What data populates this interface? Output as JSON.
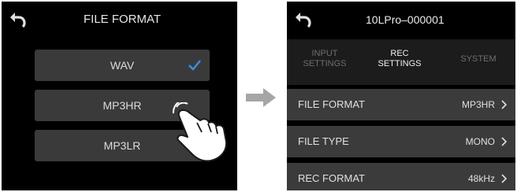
{
  "left_screen": {
    "header": {
      "back_icon": "back-arrow-icon",
      "title": "FILE FORMAT"
    },
    "options": [
      {
        "label": "WAV",
        "selected": true
      },
      {
        "label": "MP3HR",
        "selected": false
      },
      {
        "label": "MP3LR",
        "selected": false
      }
    ],
    "check_icon": "checkmark-icon",
    "pointer_icon": "tap-hand-icon"
  },
  "transition_icon": "right-arrow-icon",
  "right_screen": {
    "header": {
      "back_icon": "back-arrow-icon",
      "title": "10LPro–000001"
    },
    "tabs": [
      {
        "line1": "INPUT",
        "line2": "SETTINGS",
        "active": false
      },
      {
        "line1": "REC",
        "line2": "SETTINGS",
        "active": true
      },
      {
        "line1": "SYSTEM",
        "line2": "",
        "active": false
      }
    ],
    "rows": [
      {
        "label": "FILE FORMAT",
        "value": "MP3HR"
      },
      {
        "label": "FILE TYPE",
        "value": "MONO"
      },
      {
        "label": "REC FORMAT",
        "value": "48kHz"
      }
    ]
  },
  "colors": {
    "check": "#3b8fe0",
    "screen_bg": "#000000",
    "row_bg": "#3b3b3b",
    "arrow": "#a6a6a6"
  }
}
